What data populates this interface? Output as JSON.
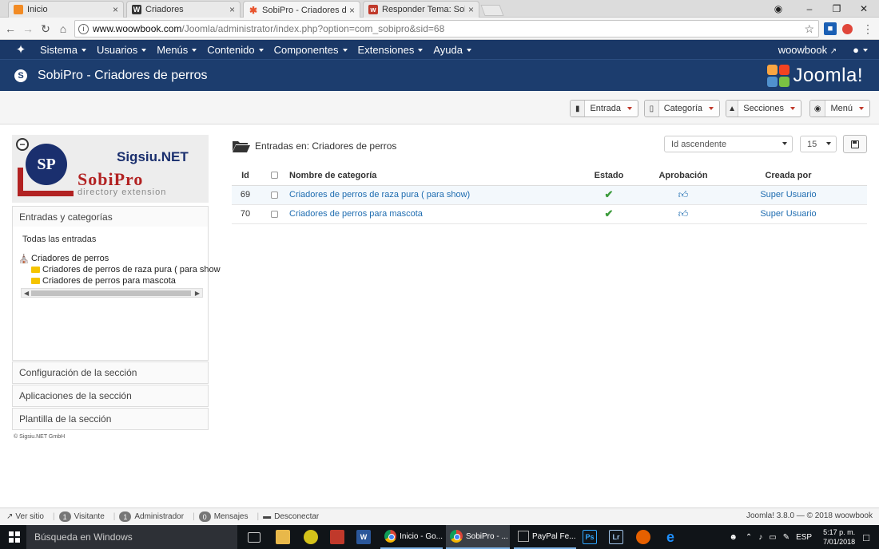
{
  "browser": {
    "tabs": [
      {
        "label": "Inicio",
        "fav_color": "#f28b24",
        "fav_glyph": "G"
      },
      {
        "label": "Criadores",
        "fav_color": "#333333",
        "fav_glyph": "W"
      },
      {
        "label": "SobiPro - Criadores de p",
        "fav_color": "#f5f5f5",
        "fav_glyph": "J"
      },
      {
        "label": "Responder Tema: Sobipr",
        "fav_color": "#c0392b",
        "fav_glyph": "w"
      }
    ],
    "url_host": "www.woowbook.com",
    "url_path": "/Joomla/administrator/index.php?option=com_sobipro&sid=68"
  },
  "topnav": {
    "items": [
      "Sistema",
      "Usuarios",
      "Menús",
      "Contenido",
      "Componentes",
      "Extensiones",
      "Ayuda"
    ],
    "user": "woowbook"
  },
  "header": {
    "title": "SobiPro - Criadores de perros",
    "brand": "Joomla!"
  },
  "toolbar": {
    "entrada": "Entrada",
    "categoria": "Categoría",
    "secciones": "Secciones",
    "menu": "Menú"
  },
  "sidebar": {
    "logo_top": "Sigsiu.NET",
    "logo_main": "SobiPro",
    "logo_sub": "directory extension",
    "logo_circle": "SP",
    "entries_panel": "Entradas y categorías",
    "all_entries": "Todas las entradas",
    "tree": {
      "root": "Criadores de perros",
      "children": [
        "Criadores de perros de raza pura ( para show",
        "Criadores de perros para mascota"
      ]
    },
    "config": "Configuración de la sección",
    "apps": "Aplicaciones de la sección",
    "template": "Plantilla de la sección",
    "copyright": "© Sigsiu.NET GmbH"
  },
  "main": {
    "title": "Entradas en: Criadores de perros",
    "sort": "Id ascendente",
    "limit": "15",
    "columns": [
      "Id",
      "",
      "Nombre de categoría",
      "Estado",
      "Aprobación",
      "Creada por"
    ],
    "rows": [
      {
        "id": "69",
        "name": "Criadores de perros de raza pura ( para show)",
        "author": "Super Usuario"
      },
      {
        "id": "70",
        "name": "Criadores de perros para mascota",
        "author": "Super Usuario"
      }
    ]
  },
  "statusbar": {
    "view_site": "Ver sitio",
    "visitors_count": "1",
    "visitors_label": "Visitante",
    "admin_count": "1",
    "admin_label": "Administrador",
    "messages_count": "0",
    "messages_label": "Mensajes",
    "logout": "Desconectar",
    "version": "Joomla! 3.8.0 — © 2018 woowbook"
  },
  "taskbar": {
    "search": "Búsqueda en Windows",
    "apps": [
      "Inicio - Go...",
      "SobiPro - ...",
      "PayPal Fe..."
    ],
    "lang": "ESP",
    "time": "5:17 p. m.",
    "date": "7/01/2018"
  }
}
